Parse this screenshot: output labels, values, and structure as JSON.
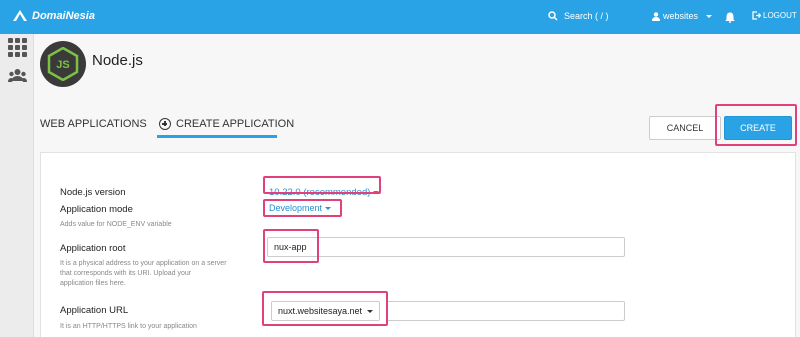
{
  "topbar": {
    "brand": "DomaiNesia",
    "search_label": "Search ( / )",
    "user_label": "websites",
    "logout_label": "LOGOUT"
  },
  "sidebar": {
    "icons": [
      "grid-icon",
      "users-icon"
    ]
  },
  "page": {
    "title": "Node.js",
    "logo_text": "JS"
  },
  "tabs": {
    "web_applications": "WEB APPLICATIONS",
    "create_application": "CREATE APPLICATION"
  },
  "buttons": {
    "cancel": "CANCEL",
    "create": "CREATE"
  },
  "form": {
    "nodejs_version_label": "Node.js version",
    "nodejs_version_value": "10.22.0 (recommended)",
    "app_mode_label": "Application mode",
    "app_mode_value": "Development",
    "app_mode_help": "Adds value for NODE_ENV variable",
    "app_root_label": "Application root",
    "app_root_value": "nux-app",
    "app_root_help_1": "It is a physical address to your application on a server",
    "app_root_help_2": "that corresponds with its URI. Upload your",
    "app_root_help_3": "application files here.",
    "app_url_label": "Application URL",
    "app_url_domain": "nuxt.websitesaya.net",
    "app_url_path": "",
    "app_url_help": "It is an HTTP/HTTPS link to your application"
  },
  "colors": {
    "topbar": "#2aa3e6",
    "accent": "#2aa3e6",
    "highlight": "#e0407c"
  }
}
